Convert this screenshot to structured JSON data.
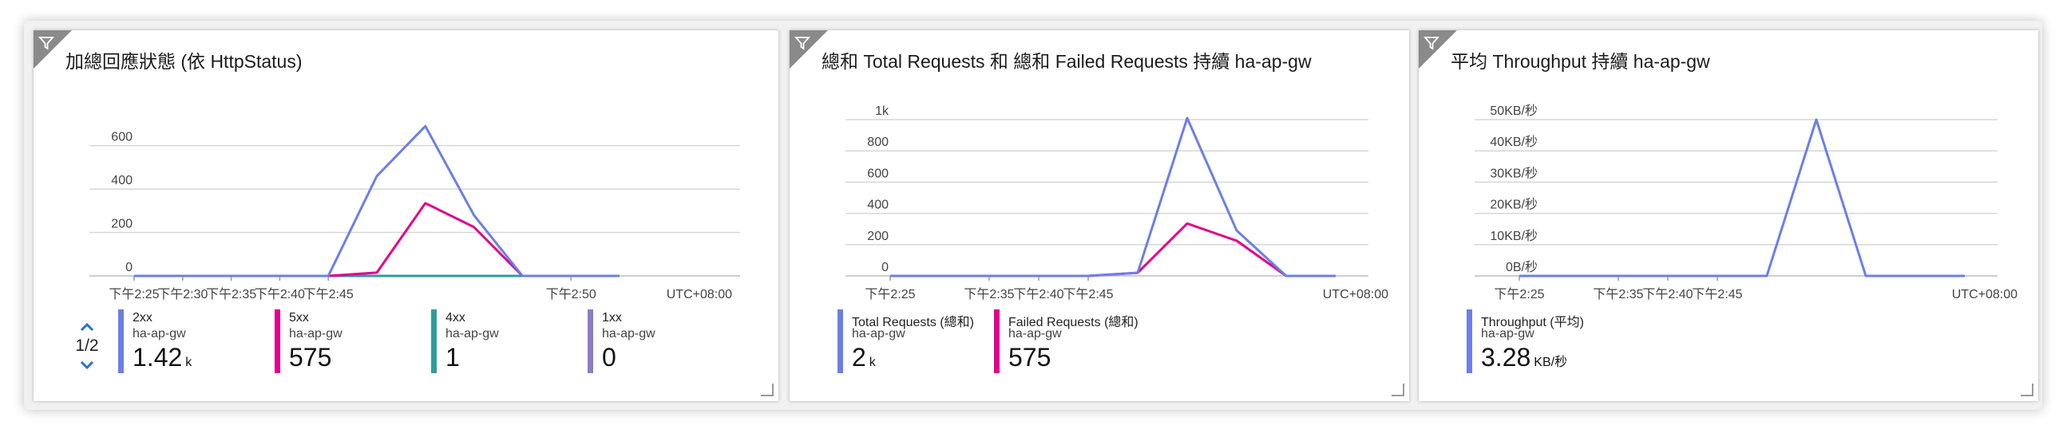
{
  "tiles": [
    {
      "title": "加總回應狀態 (依 HttpStatus)",
      "pager": "1/2",
      "legend": [
        {
          "name": "2xx",
          "sub": "ha-ap-gw",
          "value": "1.42",
          "unit": "k",
          "color": "#6b7fe8"
        },
        {
          "name": "5xx",
          "sub": "ha-ap-gw",
          "value": "575",
          "unit": "",
          "color": "#e3008c"
        },
        {
          "name": "4xx",
          "sub": "ha-ap-gw",
          "value": "1",
          "unit": "",
          "color": "#2e9c9c"
        },
        {
          "name": "1xx",
          "sub": "ha-ap-gw",
          "value": "0",
          "unit": "",
          "color": "#8c7cc8"
        }
      ]
    },
    {
      "title": "總和 Total Requests 和 總和 Failed Requests 持續 ha-ap-gw",
      "legend": [
        {
          "name": "Total Requests (總和)",
          "sub": "ha-ap-gw",
          "value": "2",
          "unit": "k",
          "color": "#6b7fe8"
        },
        {
          "name": "Failed Requests (總和)",
          "sub": "ha-ap-gw",
          "value": "575",
          "unit": "",
          "color": "#e3008c"
        }
      ]
    },
    {
      "title": "平均 Throughput 持續 ha-ap-gw",
      "legend": [
        {
          "name": "Throughput (平均)",
          "sub": "ha-ap-gw",
          "value": "3.28",
          "unit": "KB/秒",
          "color": "#6b7fe8"
        }
      ]
    }
  ],
  "chart_data": [
    {
      "type": "line",
      "title": "加總回應狀態 (依 HttpStatus)",
      "timezone": "UTC+08:00",
      "x": [
        "下午2:25",
        "下午2:30",
        "下午2:35",
        "下午2:40",
        "下午2:45",
        "下午2:46",
        "下午2:47",
        "下午2:48",
        "下午2:49",
        "下午2:50",
        "下午2:55"
      ],
      "xticks": [
        "下午2:25",
        "下午2:30",
        "下午2:35",
        "下午2:40",
        "下午2:45",
        "下午2:50"
      ],
      "yticks": [
        0,
        200,
        400,
        600
      ],
      "ylim": [
        0,
        720
      ],
      "grid": true,
      "series": [
        {
          "name": "2xx",
          "color": "#6b7fe8",
          "values": [
            0,
            0,
            0,
            0,
            0,
            460,
            690,
            280,
            0,
            0,
            0
          ]
        },
        {
          "name": "5xx",
          "color": "#e3008c",
          "values": [
            0,
            0,
            0,
            0,
            0,
            15,
            335,
            225,
            0,
            0,
            0
          ]
        },
        {
          "name": "4xx",
          "color": "#2e9c9c",
          "values": [
            0,
            0,
            0,
            0,
            0,
            0,
            0,
            0,
            0,
            0,
            0
          ]
        },
        {
          "name": "1xx",
          "color": "#8c7cc8",
          "values": [
            0,
            0,
            0,
            0,
            0,
            0,
            0,
            0,
            0,
            0,
            0
          ]
        },
        {
          "color": "#2a8a2a",
          "values": [
            0,
            0,
            0,
            0,
            0,
            0,
            0,
            0,
            0,
            0,
            0
          ]
        }
      ]
    },
    {
      "type": "line",
      "title": "總和 Total Requests 和 總和 Failed Requests 持續 ha-ap-gw",
      "timezone": "UTC+08:00",
      "x": [
        "下午2:25",
        "下午2:30",
        "下午2:35",
        "下午2:40",
        "下午2:45",
        "下午2:46",
        "下午2:47",
        "下午2:48",
        "下午2:49",
        "下午2:55"
      ],
      "xticks": [
        "下午2:25",
        "下午2:35",
        "下午2:40",
        "下午2:45"
      ],
      "yticks": [
        "0",
        "200",
        "400",
        "600",
        "800",
        "1k"
      ],
      "ylim": [
        0,
        1000
      ],
      "grid": true,
      "series": [
        {
          "name": "Total Requests (總和)",
          "color": "#6b7fe8",
          "values": [
            0,
            0,
            0,
            0,
            0,
            20,
            1010,
            290,
            0,
            0
          ]
        },
        {
          "name": "Failed Requests (總和)",
          "color": "#e3008c",
          "values": [
            0,
            0,
            0,
            0,
            0,
            20,
            335,
            225,
            0,
            0
          ]
        }
      ]
    },
    {
      "type": "line",
      "title": "平均 Throughput 持續 ha-ap-gw",
      "timezone": "UTC+08:00",
      "x": [
        "下午2:25",
        "下午2:30",
        "下午2:35",
        "下午2:40",
        "下午2:45",
        "下午2:46",
        "下午2:47",
        "下午2:48",
        "下午2:49",
        "下午2:55"
      ],
      "xticks": [
        "下午2:25",
        "下午2:35",
        "下午2:40",
        "下午2:45"
      ],
      "yticks": [
        "0B/秒",
        "10KB/秒",
        "20KB/秒",
        "30KB/秒",
        "40KB/秒",
        "50KB/秒"
      ],
      "ylim": [
        0,
        50
      ],
      "grid": true,
      "series": [
        {
          "name": "Throughput (平均)",
          "color": "#6b7fe8",
          "values": [
            0,
            0,
            0,
            0,
            0,
            0,
            50,
            0,
            0,
            0
          ]
        }
      ]
    }
  ]
}
